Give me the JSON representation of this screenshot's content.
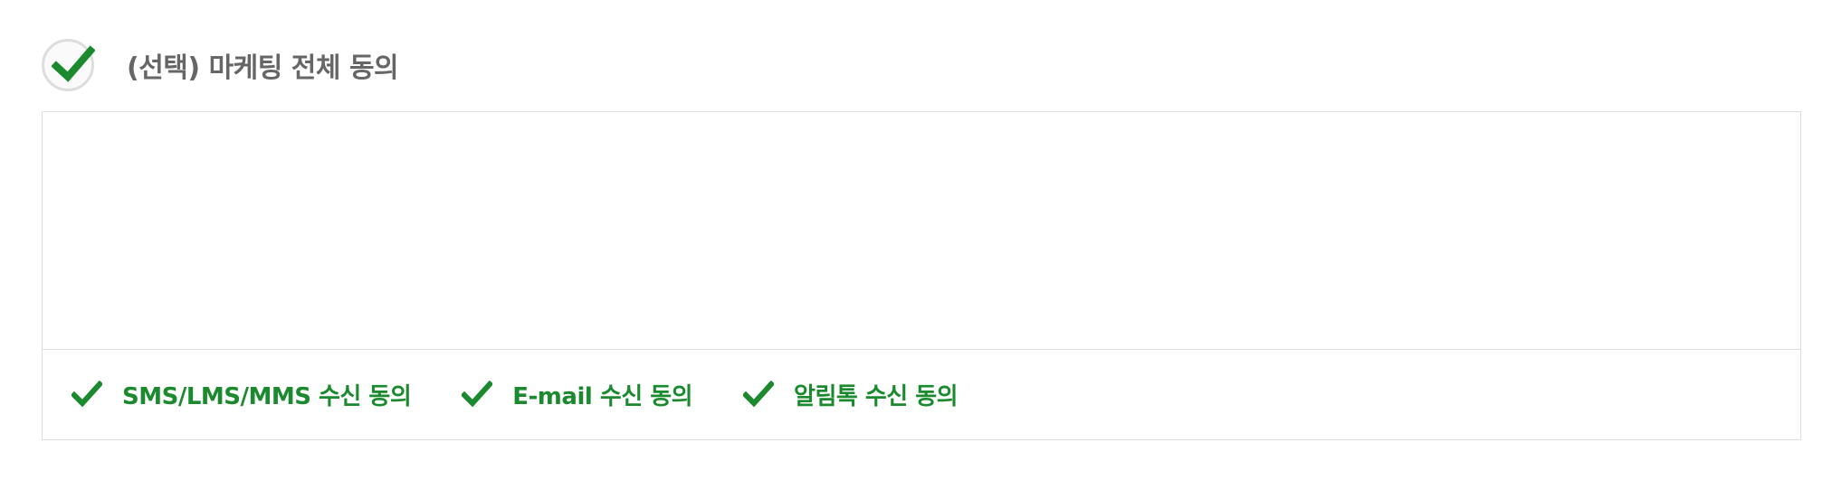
{
  "marketing": {
    "title": "(선택) 마케팅 전체 동의",
    "all_checked": true,
    "check_color": "#1b8a2e",
    "terms_text": "",
    "options": [
      {
        "label": "SMS/LMS/MMS 수신 동의",
        "checked": true
      },
      {
        "label": "E-mail 수신 동의",
        "checked": true
      },
      {
        "label": "알림톡 수신 동의",
        "checked": true
      }
    ]
  }
}
